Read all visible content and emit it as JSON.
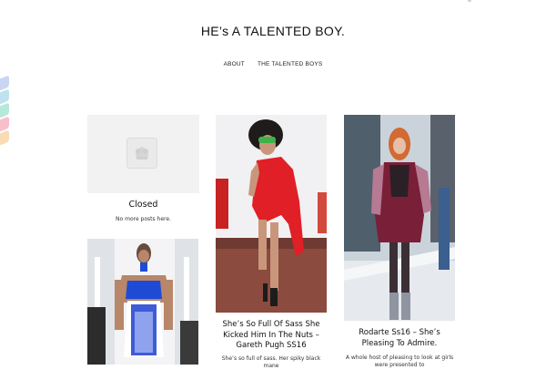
{
  "site": {
    "title": "HE’s A TALENTED BOY."
  },
  "nav": {
    "items": [
      {
        "label": "ABOUT"
      },
      {
        "label": "THE TALENTED BOYS"
      }
    ]
  },
  "cards": [
    {
      "title": "Closed",
      "text": "No more posts here."
    },
    {
      "title": "She’s So Full Of Sass She Kicked Him In The Nuts – Gareth Pugh SS16",
      "text": "She’s so full of sass. Her spiky black mane"
    },
    {
      "title": "Rodarte Ss16 – She’s Pleasing To Admire.",
      "text": "A whole host of pleasing to look at girls were presented to"
    },
    {
      "title": "",
      "text": ""
    }
  ],
  "icons": {
    "placeholder": "image-placeholder-icon",
    "share": "share-stack-icon"
  },
  "colors": {
    "background": "#ffffff",
    "text": "#111111",
    "placeholder": "#f2f2f2"
  }
}
